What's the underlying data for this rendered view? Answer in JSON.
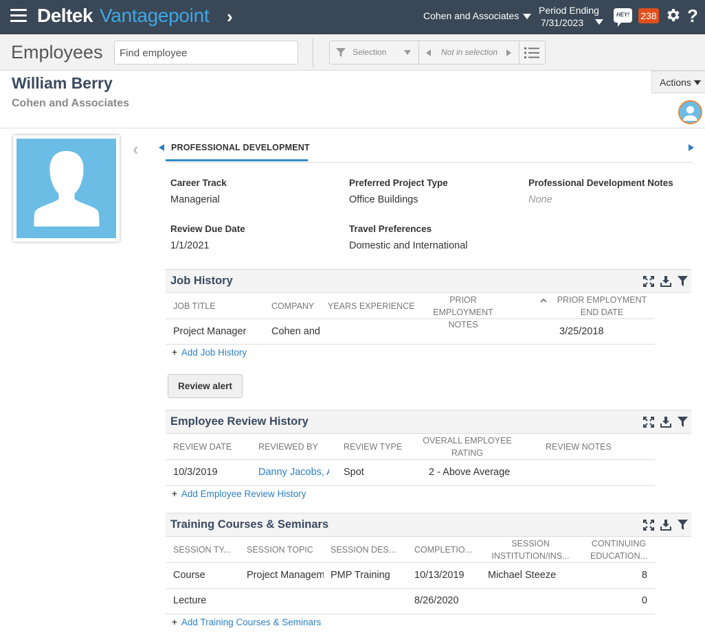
{
  "topbar": {
    "brand_main": "Deltek",
    "brand_product": "Vantagepoint",
    "company": "Cohen and Associates",
    "period_label": "Period Ending",
    "period_date": "7/31/2023",
    "hey_label": "HEY!",
    "notification_count": "238",
    "help_label": "?"
  },
  "subbar": {
    "title": "Employees",
    "find_placeholder": "Find employee",
    "selection_label": "Selection",
    "not_in_selection_label": "Not in selection"
  },
  "record": {
    "name": "William Berry",
    "organization": "Cohen and Associates",
    "actions_label": "Actions"
  },
  "tab": {
    "label": "PROFESSIONAL DEVELOPMENT"
  },
  "fields": {
    "career_track_label": "Career Track",
    "career_track_value": "Managerial",
    "project_type_label": "Preferred Project Type",
    "project_type_value": "Office Buildings",
    "notes_label": "Professional Development Notes",
    "notes_value": "None",
    "review_due_label": "Review Due Date",
    "review_due_value": "1/1/2021",
    "travel_label": "Travel Preferences",
    "travel_value": "Domestic and International"
  },
  "job_history": {
    "title": "Job History",
    "columns": [
      "JOB TITLE",
      "COMPANY",
      "YEARS EXPERIENCE",
      "PRIOR EMPLOYMENT NOTES",
      "PRIOR EMPLOYMENT END DATE"
    ],
    "rows": [
      [
        "Project Manager",
        "Cohen and",
        "",
        "",
        "3/25/2018"
      ]
    ],
    "add_label": "Add Job History"
  },
  "review_alert_label": "Review alert",
  "review_history": {
    "title": "Employee Review History",
    "columns": [
      "REVIEW DATE",
      "REVIEWED BY",
      "REVIEW TYPE",
      "OVERALL EMPLOYEE RATING",
      "REVIEW NOTES"
    ],
    "rows": [
      [
        "10/3/2019",
        "Danny Jacobs, A",
        "Spot",
        "2 - Above Average",
        ""
      ]
    ],
    "add_label": "Add Employee Review History"
  },
  "training": {
    "title": "Training Courses & Seminars",
    "columns": [
      "SESSION TY...",
      "SESSION TOPIC",
      "SESSION DES...",
      "COMPLETIO...",
      "SESSION INSTITUTION/INS...",
      "CONTINUING EDUCATION..."
    ],
    "rows": [
      [
        "Course",
        "Project Managem",
        "PMP Training",
        "10/13/2019",
        "Michael Steeze",
        "8"
      ],
      [
        "Lecture",
        "",
        "",
        "8/26/2020",
        "",
        "0"
      ]
    ],
    "add_label": "Add Training Courses & Seminars"
  },
  "colors": {
    "topbar_bg": "#3a4756",
    "brand_accent": "#3ea8e5",
    "link": "#2b7fc1",
    "badge": "#e0501c",
    "avatar_bg": "#6bbde6"
  },
  "icons": [
    "hamburger-icon",
    "chevron-right-icon",
    "chat-hey-icon",
    "gear-icon",
    "help-icon",
    "filter-icon",
    "list-icon",
    "avatar-icon",
    "expand-icon",
    "download-icon",
    "funnel-icon",
    "sort-asc-icon"
  ]
}
